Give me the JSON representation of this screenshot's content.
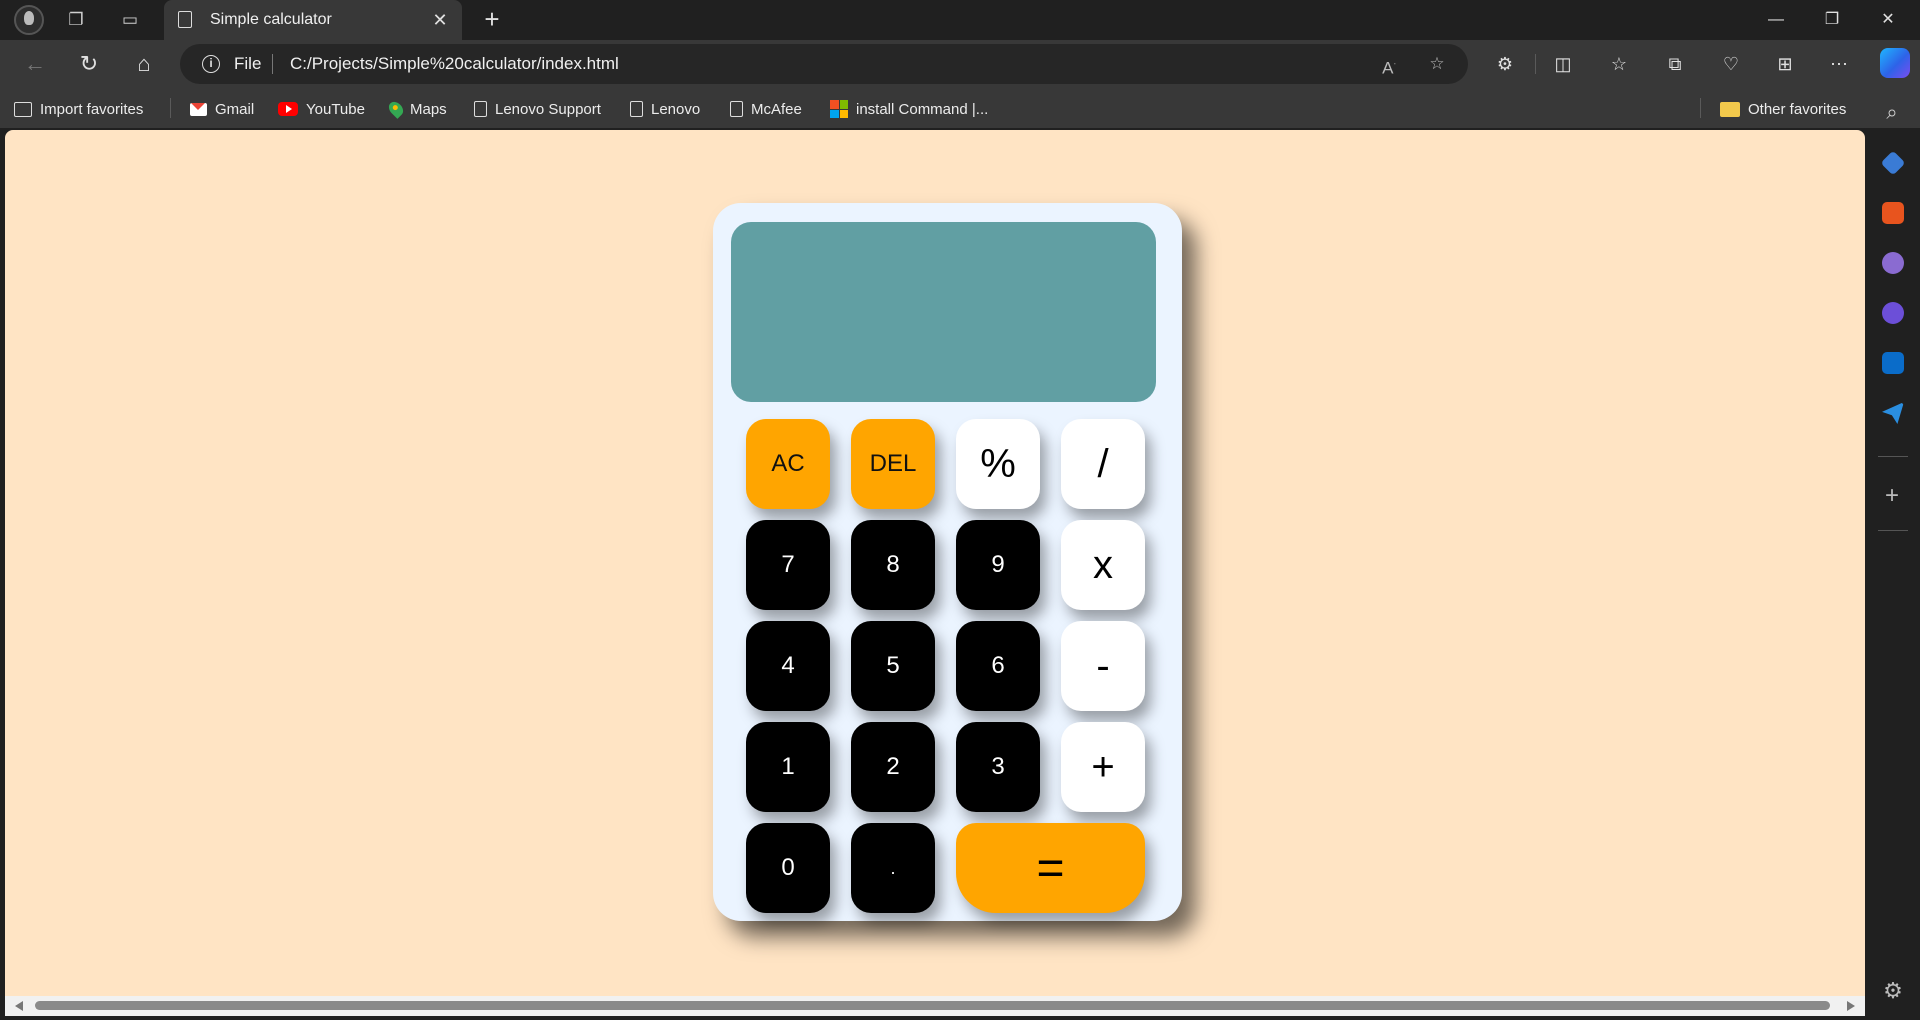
{
  "browser": {
    "tab_title": "Simple calculator",
    "address": {
      "scheme_label": "File",
      "url": "C:/Projects/Simple%20calculator/index.html"
    },
    "favorites": [
      {
        "label": "Import favorites",
        "icon": "import-icon"
      },
      {
        "label": "Gmail",
        "icon": "gmail-icon"
      },
      {
        "label": "YouTube",
        "icon": "youtube-icon"
      },
      {
        "label": "Maps",
        "icon": "maps-icon"
      },
      {
        "label": "Lenovo Support",
        "icon": "page-icon"
      },
      {
        "label": "Lenovo",
        "icon": "page-icon"
      },
      {
        "label": "McAfee",
        "icon": "page-icon"
      },
      {
        "label": "install Command |...",
        "icon": "microsoft-icon"
      }
    ],
    "other_favorites": "Other favorites"
  },
  "calculator": {
    "display_value": "",
    "colors": {
      "page_background": "#ffe4c4",
      "body": "#ebf4ff",
      "display": "#619fa3",
      "function_keys": "#ffa500",
      "number_keys": "#000000",
      "operator_keys": "#ffffff"
    },
    "keys": {
      "ac": "AC",
      "del": "DEL",
      "percent": "%",
      "divide": "/",
      "seven": "7",
      "eight": "8",
      "nine": "9",
      "multiply": "x",
      "four": "4",
      "five": "5",
      "six": "6",
      "minus": "-",
      "one": "1",
      "two": "2",
      "three": "3",
      "plus": "+",
      "zero": "0",
      "decimal": ".",
      "equals": "="
    }
  }
}
